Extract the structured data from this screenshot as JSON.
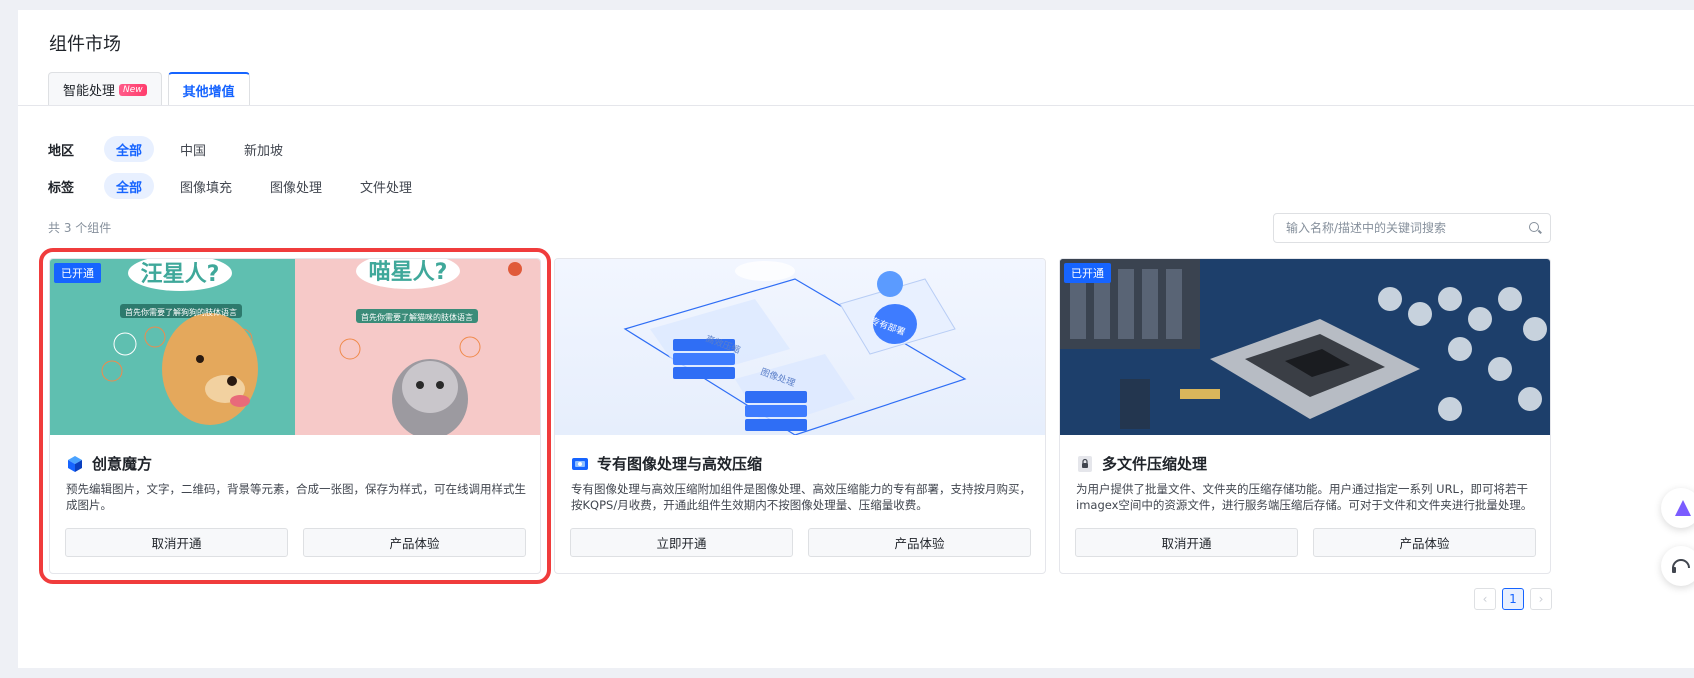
{
  "page_title": "组件市场",
  "tabs": [
    {
      "label": "智能处理",
      "badge": "New"
    },
    {
      "label": "其他增值"
    }
  ],
  "filters": {
    "region": {
      "label": "地区",
      "options": [
        "全部",
        "中国",
        "新加坡"
      ],
      "selected": "全部"
    },
    "tag": {
      "label": "标签",
      "options": [
        "全部",
        "图像填充",
        "图像处理",
        "文件处理"
      ],
      "selected": "全部"
    }
  },
  "count_text": "共 3 个组件",
  "search": {
    "placeholder": "输入名称/描述中的关键词搜索"
  },
  "cards": [
    {
      "badge": "已开通",
      "title": "创意魔方",
      "desc": "预先编辑图片，文字，二维码，背景等元素，合成一张图，保存为样式，可在线调用样式生成图片。",
      "buttons": [
        "取消开通",
        "产品体验"
      ],
      "img_text_left": "汪星人?",
      "img_text_right": "喵星人?",
      "img_sub_left": "首先你需要了解狗狗的肢体语言",
      "img_sub_right": "首先你需要了解猫咪的肢体语言"
    },
    {
      "badge": "",
      "title": "专有图像处理与高效压缩",
      "desc": "专有图像处理与高效压缩附加组件是图像处理、高效压缩能力的专有部署，支持按月购买，按KQPS/月收费，开通此组件生效期内不按图像处理量、压缩量收费。",
      "buttons": [
        "立即开通",
        "产品体验"
      ],
      "img_labels": [
        "高效压缩",
        "图像处理",
        "专有部署"
      ]
    },
    {
      "badge": "已开通",
      "title": "多文件压缩处理",
      "desc": "为用户提供了批量文件、文件夹的压缩存储功能。用户通过指定一系列 URL，即可将若干imagex空间中的资源文件，进行服务端压缩后存储。可对于文件和文件夹进行批量处理。",
      "buttons": [
        "取消开通",
        "产品体验"
      ]
    }
  ],
  "pagination": {
    "prev": "‹",
    "current": "1",
    "next": "›"
  },
  "colors": {
    "accent": "#1664ff",
    "highlight": "#f03c3c"
  }
}
